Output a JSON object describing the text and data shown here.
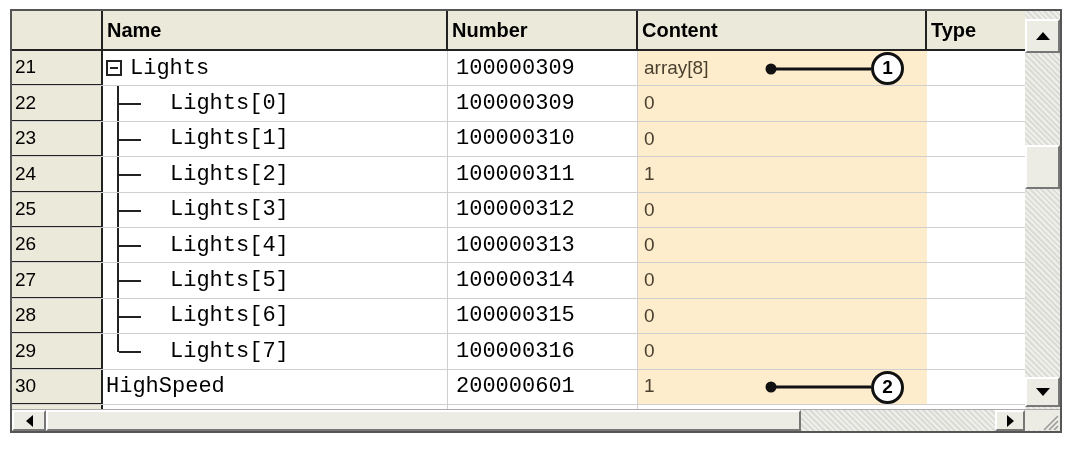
{
  "table": {
    "columns": [
      {
        "label": "Name"
      },
      {
        "label": "Number"
      },
      {
        "label": "Content"
      },
      {
        "label": "Type"
      }
    ],
    "rows": [
      {
        "row": "21",
        "name": "Lights",
        "number": "100000309",
        "content": "array[8]",
        "callout": "1",
        "expanded": true,
        "children": [
          {
            "row": "22",
            "name": "Lights[0]",
            "number": "100000309",
            "content": "0"
          },
          {
            "row": "23",
            "name": "Lights[1]",
            "number": "100000310",
            "content": "0"
          },
          {
            "row": "24",
            "name": "Lights[2]",
            "number": "100000311",
            "content": "1"
          },
          {
            "row": "25",
            "name": "Lights[3]",
            "number": "100000312",
            "content": "0"
          },
          {
            "row": "26",
            "name": "Lights[4]",
            "number": "100000313",
            "content": "0"
          },
          {
            "row": "27",
            "name": "Lights[5]",
            "number": "100000314",
            "content": "0"
          },
          {
            "row": "28",
            "name": "Lights[6]",
            "number": "100000315",
            "content": "0"
          },
          {
            "row": "29",
            "name": "Lights[7]",
            "number": "100000316",
            "content": "0"
          }
        ]
      },
      {
        "row": "30",
        "name": "HighSpeed",
        "number": "200000601",
        "content": "1",
        "callout": "2"
      }
    ]
  }
}
